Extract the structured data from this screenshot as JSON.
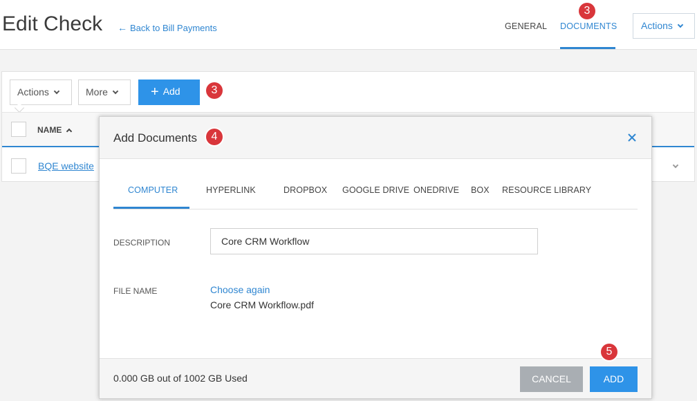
{
  "header": {
    "title": "Edit Check",
    "back_link": "Back to Bill Payments",
    "tabs": [
      {
        "label": "GENERAL"
      },
      {
        "label": "DOCUMENTS"
      }
    ],
    "actions_label": "Actions"
  },
  "toolbar": {
    "actions_label": "Actions",
    "more_label": "More",
    "add_label": "Add"
  },
  "table": {
    "column_name": "NAME",
    "rows": [
      {
        "name": "BQE website"
      }
    ]
  },
  "modal": {
    "title": "Add Documents",
    "source_tabs": [
      "COMPUTER",
      "HYPERLINK",
      "DROPBOX",
      "GOOGLE DRIVE",
      "ONEDRIVE",
      "BOX",
      "RESOURCE LIBRARY"
    ],
    "description_label": "DESCRIPTION",
    "description_value": "Core CRM Workflow",
    "file_name_label": "FILE NAME",
    "choose_again": "Choose again",
    "file_name": "Core CRM Workflow.pdf",
    "storage_text": "0.000 GB out of 1002 GB Used",
    "cancel_label": "CANCEL",
    "add_label": "ADD"
  },
  "badges": [
    "3",
    "3",
    "4",
    "5"
  ],
  "colors": {
    "accent": "#2f86d1",
    "primary_button": "#2e93e8",
    "badge": "#d9363b",
    "cancel_button": "#a9aeb3"
  }
}
